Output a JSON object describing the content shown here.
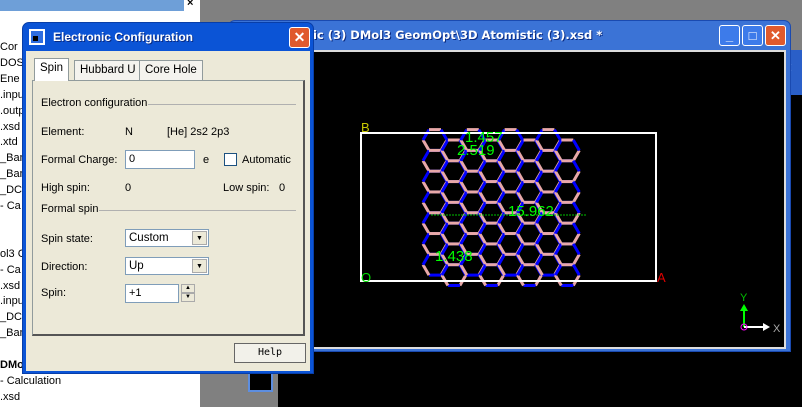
{
  "explorer": {
    "items": [
      {
        "label": "Cor",
        "bold": false
      },
      {
        "label": "DOS",
        "bold": false
      },
      {
        "label": "Ene",
        "bold": false
      },
      {
        "label": ".inpu",
        "bold": false
      },
      {
        "label": ".outp",
        "bold": false
      },
      {
        "label": ".xsd",
        "bold": false
      },
      {
        "label": ".xtd",
        "bold": false
      },
      {
        "label": "_Ban",
        "bold": false
      },
      {
        "label": "_Ban",
        "bold": false
      },
      {
        "label": "_DC",
        "bold": false
      },
      {
        "label": "- Ca",
        "bold": false
      },
      {
        "label": "",
        "bold": false
      },
      {
        "label": "",
        "bold": false
      },
      {
        "label": "ol3 G",
        "bold": false
      },
      {
        "label": "- Ca",
        "bold": false
      },
      {
        "label": ".xsd",
        "bold": false
      },
      {
        "label": ".inpu",
        "bold": false
      },
      {
        "label": "_DC",
        "bold": false
      },
      {
        "label": "_Ban",
        "bold": false
      },
      {
        "label": "",
        "bold": false
      },
      {
        "label": "DMo",
        "bold": true
      },
      {
        "label": "- Calculation",
        "bold": false
      },
      {
        "label": ".xsd",
        "bold": false
      }
    ]
  },
  "main_window": {
    "title": "ic (3) DMol3 GeomOpt\\3D Atomistic (3).xsd *",
    "cell_labels": {
      "b": "B",
      "o": "O",
      "a": "A"
    },
    "measurements": [
      "1.457",
      "2.519",
      "15.962",
      "1.438"
    ],
    "axes": {
      "x": "X",
      "y": "Y"
    }
  },
  "dialog": {
    "title": "Electronic Configuration",
    "tabs": [
      "Spin",
      "Hubbard U",
      "Core Hole"
    ],
    "active_tab": "Spin",
    "electron_config_group": "Electron configuration",
    "element_label": "Element:",
    "element_value": "N",
    "element_config": "[He] 2s2 2p3",
    "formal_charge_label": "Formal Charge:",
    "formal_charge_value": "0",
    "formal_charge_unit": "e",
    "automatic_label": "Automatic",
    "automatic_checked": false,
    "high_spin_label": "High spin:",
    "high_spin_value": "0",
    "low_spin_label": "Low spin:",
    "low_spin_value": "0",
    "formal_spin_group": "Formal spin",
    "spin_state_label": "Spin state:",
    "spin_state_value": "Custom",
    "direction_label": "Direction:",
    "direction_value": "Up",
    "spin_label": "Spin:",
    "spin_value": "+1",
    "help_label": "Help"
  },
  "colors": {
    "nitrogen": "#0000ff",
    "boron": "#e8a8a8",
    "measure": "#00ff00",
    "cell": "#ffffff"
  }
}
